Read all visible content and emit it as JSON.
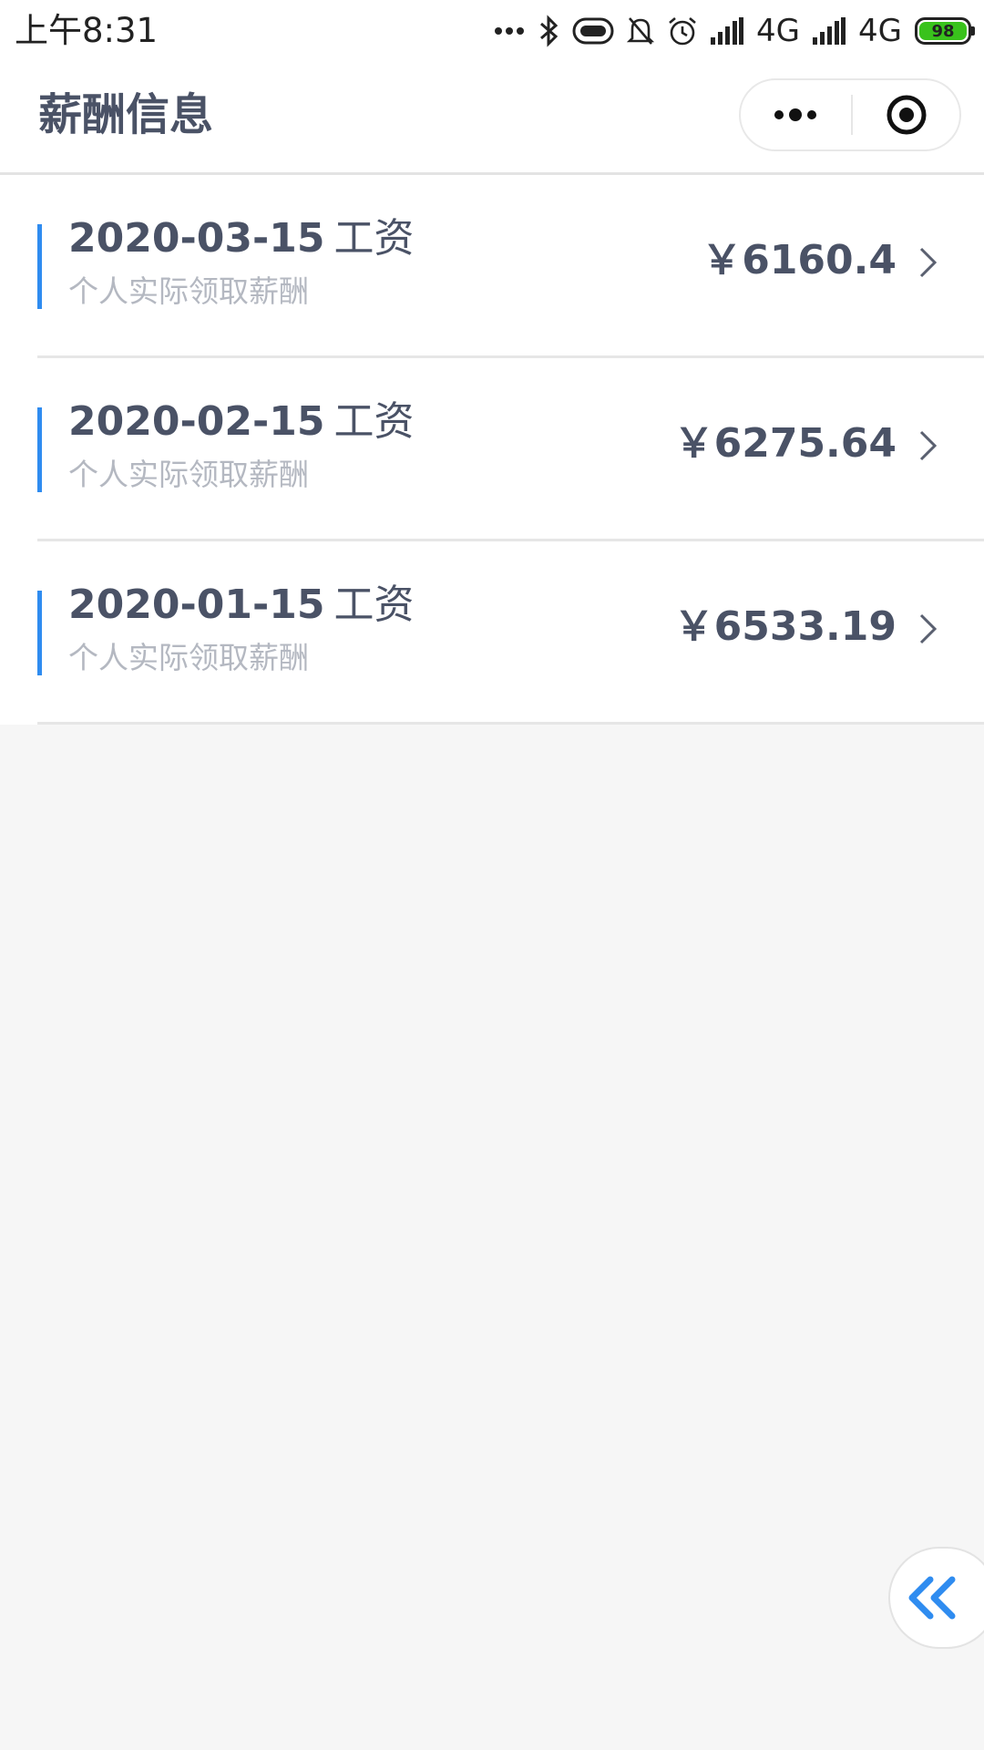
{
  "status_bar": {
    "time": "上午8:31",
    "network_1": "4G",
    "network_2": "4G",
    "battery": "98",
    "icons": [
      "more-dots-icon",
      "bluetooth-icon",
      "nfc-icon",
      "mute-bell-icon",
      "alarm-icon",
      "signal-icon",
      "signal-icon",
      "battery-icon"
    ]
  },
  "nav": {
    "title": "薪酬信息",
    "more_icon": "more-dots-icon",
    "close_icon": "target-close-icon"
  },
  "salary_list": [
    {
      "date": "2020-03-15",
      "type": "工资",
      "subtitle": "个人实际领取薪酬",
      "amount": "￥6160.4"
    },
    {
      "date": "2020-02-15",
      "type": "工资",
      "subtitle": "个人实际领取薪酬",
      "amount": "￥6275.64"
    },
    {
      "date": "2020-01-15",
      "type": "工资",
      "subtitle": "个人实际领取薪酬",
      "amount": "￥6533.19"
    }
  ],
  "floating_button": {
    "icon": "double-chevron-left-icon"
  },
  "colors": {
    "accent": "#2f8cf0",
    "text_primary": "#4a5266",
    "text_secondary": "#b4b8c1",
    "background": "#f6f6f6"
  }
}
